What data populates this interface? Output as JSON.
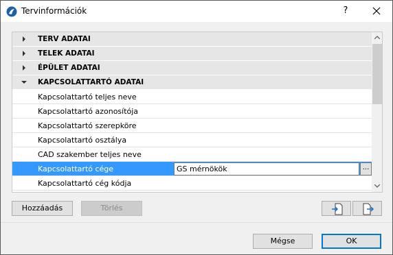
{
  "window": {
    "title": "Tervinformációk",
    "help_label": "?",
    "close_label": "✕",
    "icon": "archicad-app-icon"
  },
  "tree": {
    "groups": [
      {
        "label": "TERV ADATAI",
        "expanded": false
      },
      {
        "label": "TELEK ADATAI",
        "expanded": false
      },
      {
        "label": "ÉPÜLET ADATAI",
        "expanded": false
      },
      {
        "label": "KAPCSOLATTARTÓ ADATAI",
        "expanded": true
      }
    ],
    "items": [
      {
        "label": "Kapcsolattartó teljes neve"
      },
      {
        "label": "Kapcsolattartó azonosítója"
      },
      {
        "label": "Kapcsolattartó szerepköre"
      },
      {
        "label": "Kapcsolattartó osztálya"
      },
      {
        "label": "CAD szakember teljes neve"
      },
      {
        "label": "Kapcsolattartó cége",
        "value": "GS mérnökök",
        "selected": true,
        "browse_label": "..."
      },
      {
        "label": "Kapcsolattartó cég kódja"
      }
    ]
  },
  "buttons": {
    "add": "Hozzáadás",
    "delete": "Törlés",
    "cancel": "Mégse",
    "ok": "OK"
  },
  "colors": {
    "selection": "#3399ff",
    "group_bg": "#e6e6e6",
    "accent": "#0078d7"
  }
}
